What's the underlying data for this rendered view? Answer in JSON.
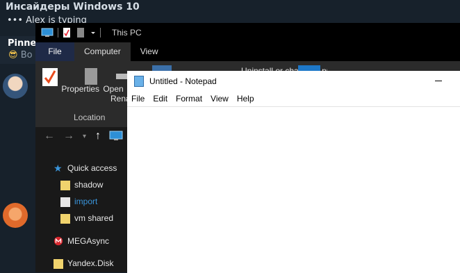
{
  "telegram": {
    "chat_title": "Инсайдеры Windows 10",
    "typing_status": "••• Alex is typing",
    "pinned_label": "Pinned",
    "pinned_preview": "Bo",
    "pinned_emoji": "😎"
  },
  "explorer": {
    "title": "This PC",
    "tabs": [
      "File",
      "Computer",
      "View"
    ],
    "ribbon_buttons": [
      "Properties",
      "Open",
      "Rename"
    ],
    "ribbon_group": "Location",
    "ribbon_right_text": "Uninstall or change a program",
    "nav_pane": [
      {
        "label": "Quick access",
        "icon": "star-icon"
      },
      {
        "label": "shadow",
        "icon": "folder-icon"
      },
      {
        "label": "import",
        "icon": "folder-icon"
      },
      {
        "label": "vm shared",
        "icon": "folder-icon"
      },
      {
        "label": "MEGAsync",
        "icon": "mega-icon"
      },
      {
        "label": "Yandex.Disk",
        "icon": "folder-icon"
      }
    ]
  },
  "notepad": {
    "title": "Untitled - Notepad",
    "menu": [
      "File",
      "Edit",
      "Format",
      "View",
      "Help"
    ],
    "text": ""
  }
}
